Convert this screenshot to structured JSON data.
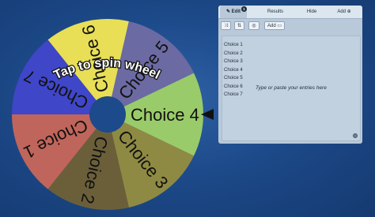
{
  "wheel": {
    "tap_text": "Tap to spin wheel",
    "segments": [
      {
        "label": "Choice 4",
        "color": "#9acb6a",
        "text_color": "#111111"
      },
      {
        "label": "Choice 3",
        "color": "#8f8a43",
        "text_color": "#111111"
      },
      {
        "label": "Choice 2",
        "color": "#6b5f3a",
        "text_color": "#ffffff"
      },
      {
        "label": "Choice 1",
        "color": "#c0655b",
        "text_color": "#111111"
      },
      {
        "label": "Choice 7",
        "color": "#3f46c8",
        "text_color": "#ffffff"
      },
      {
        "label": "Choice 6",
        "color": "#e8df56",
        "text_color": "#111111"
      },
      {
        "label": "Choice 5",
        "color": "#6c6aa3",
        "text_color": "#ffffff"
      }
    ],
    "hub_color": "#1d4a8a",
    "pointer_color": "#111111"
  },
  "panel": {
    "tabs": {
      "edit": "✎ Edit",
      "edit_badge": "1",
      "results": "Results",
      "hide": "Hide",
      "add": "Add ⊕"
    },
    "toolbar": {
      "shuffle_icon": "⤨",
      "sort_icon": "⇅",
      "image_icon": "◎",
      "add_image": "Add ▭"
    },
    "entries": [
      "Choice 1",
      "Choice 2",
      "Choice 3",
      "Choice 4",
      "Choice 5",
      "Choice 6",
      "Choice 7"
    ],
    "placeholder": "Type or paste your entries here"
  }
}
